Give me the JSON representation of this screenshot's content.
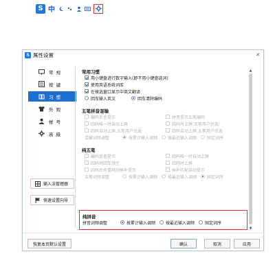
{
  "imebar": {
    "logo": "S",
    "chinese_label": "中",
    "icons": [
      "moon-icon",
      "dots-icon",
      "person-icon",
      "keyboard-icon",
      "gear-icon"
    ]
  },
  "window": {
    "title": "属性设置",
    "logo": "S"
  },
  "nav": {
    "items": [
      {
        "label": "常 规",
        "icon": "monitor-icon",
        "active": false
      },
      {
        "label": "按 键",
        "icon": "key-icon",
        "active": false
      },
      {
        "label": "习 惯",
        "icon": "habit-icon",
        "active": true
      },
      {
        "label": "外 观",
        "icon": "shirt-icon",
        "active": false
      },
      {
        "label": "帐 号",
        "icon": "account-icon",
        "active": false
      },
      {
        "label": "高 级",
        "icon": "gear-icon",
        "active": false
      }
    ],
    "buttons": [
      {
        "label": "输入法管理器",
        "icon": "grid-icon"
      },
      {
        "label": "快速设置向导",
        "icon": "flag-icon"
      }
    ]
  },
  "habits": {
    "title": "常用习惯",
    "opt1": "用小键盘进行数字输入(即不用小键盘选词)",
    "opt2": "使用英语系统词库",
    "opt3": "在候选窗口显示中英文翻译",
    "radio1": "回车输入英文",
    "radio2": "回车清除编码"
  },
  "wubi_pinyin": {
    "title": "五笔拼音混输",
    "a1": "编码反查提示",
    "b1": "拼音提示五笔编码",
    "a2": "四码唯一时自动上屏",
    "b2": "四码时上屏,五笔用户优选",
    "a3": "四码自动上屏,五笔用户优选",
    "b3": "四码自动上屏,五笔用户优选",
    "radio_label": "混输词频调整",
    "r1": "按累计输入调频",
    "r2": "按最近输入调频",
    "r3": "固定词序"
  },
  "wubi": {
    "title": "纯五笔",
    "a1": "编码反查提示",
    "b1": "四码唯一时自动上屏",
    "a2": "四码时回车顶空",
    "b2": "四码时上屏",
    "a3": "四码后有重码则候补提示",
    "b3": "候补匹配自动提示",
    "radio_label": "五笔词频调整",
    "r1": "按累计输入调频",
    "r2": "按最近输入调频",
    "r3": "固定词序"
  },
  "pinyin": {
    "title": "纯拼音",
    "radio_label": "拼音词频调整",
    "r1": "按累计输入调频",
    "r2": "按最近输入调频",
    "r3": "固定词序"
  },
  "footer": {
    "restore": "恢复本页默认设置",
    "ok": "确认",
    "cancel": "取消",
    "apply": "应用"
  },
  "colors": {
    "accent": "#1f6fd0",
    "highlight_border": "#e03030"
  }
}
